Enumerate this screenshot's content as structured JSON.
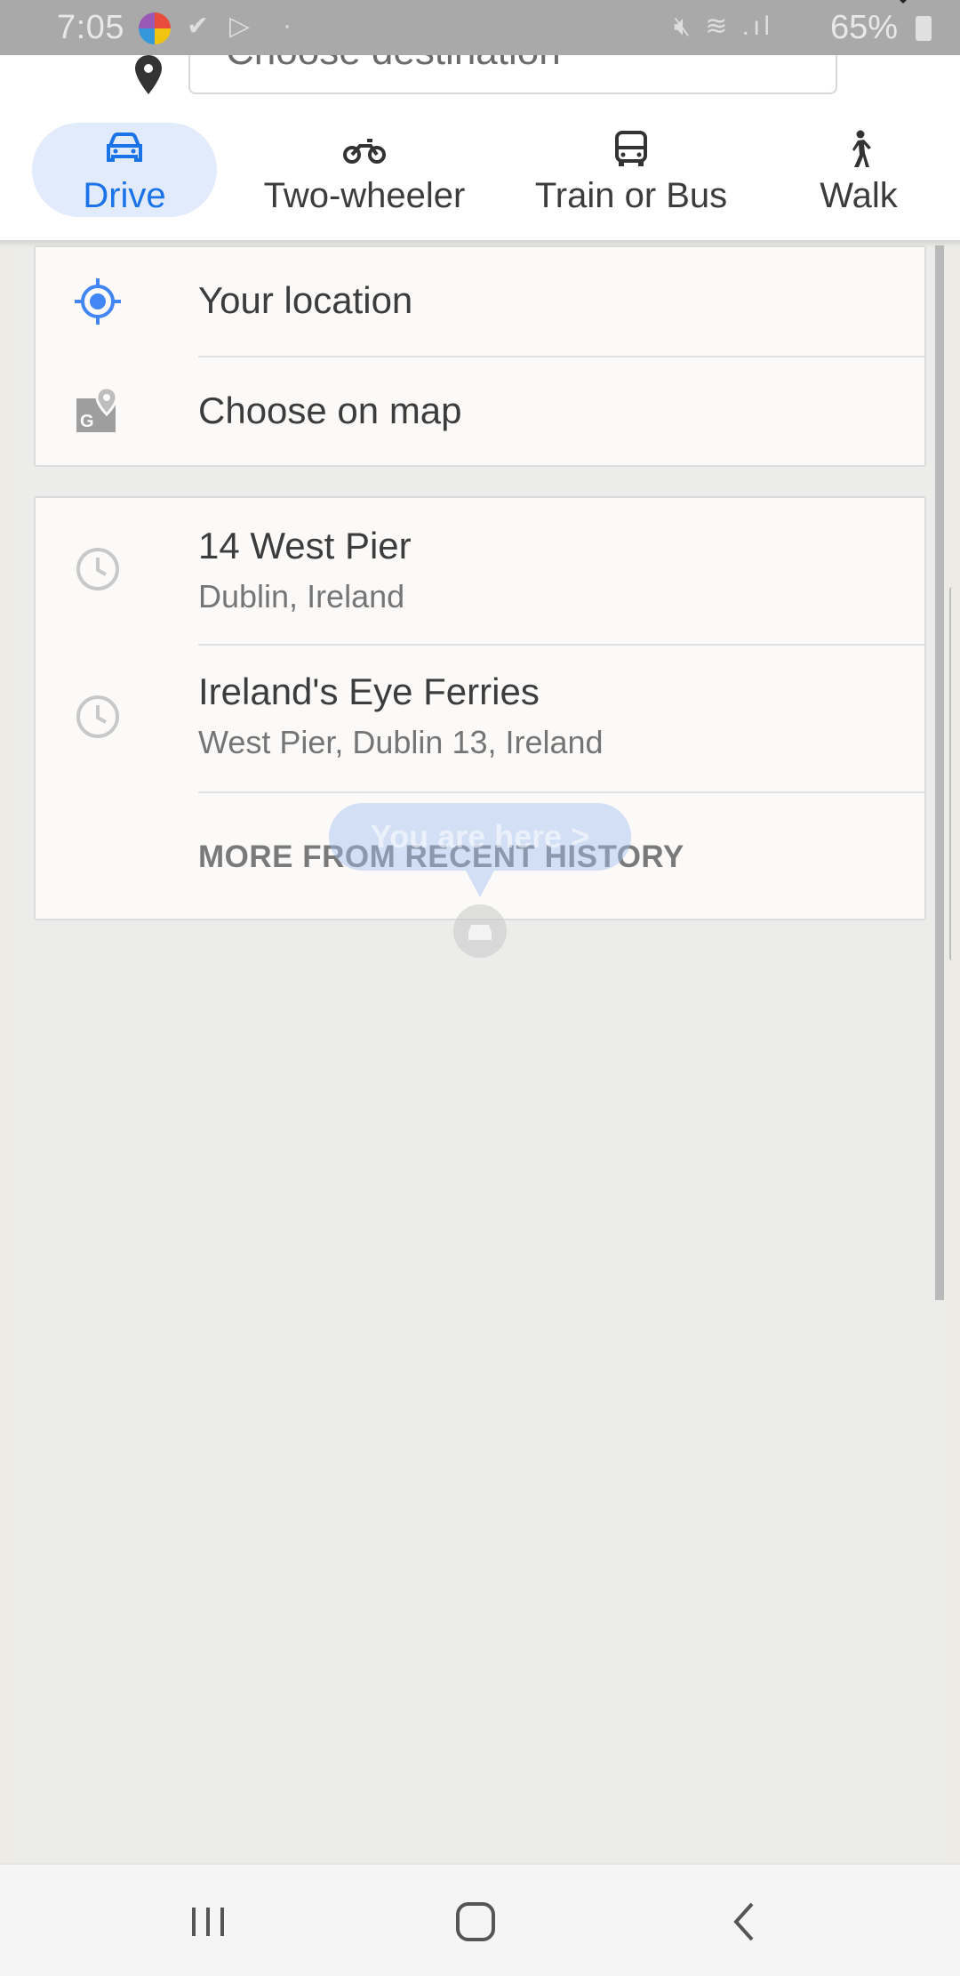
{
  "status_bar": {
    "time": "7:05",
    "battery": "65%",
    "icons": [
      "app-logo-icon",
      "check-notification-icon",
      "play-store-icon",
      "mute-icon",
      "wifi-icon",
      "signal-icon",
      "battery-icon"
    ]
  },
  "search": {
    "placeholder": "Choose destination"
  },
  "modes": [
    {
      "label": "Drive",
      "icon": "car-icon",
      "active": true
    },
    {
      "label": "Two-wheeler",
      "icon": "motorcycle-icon",
      "active": false
    },
    {
      "label": "Train or Bus",
      "icon": "bus-icon",
      "active": false
    },
    {
      "label": "Walk",
      "icon": "walk-icon",
      "active": false
    }
  ],
  "quick_options": [
    {
      "label": "Your location",
      "icon": "my-location-icon"
    },
    {
      "label": "Choose on map",
      "icon": "map-pin-icon"
    }
  ],
  "recent": [
    {
      "title": "14 West Pier",
      "subtitle": "Dublin, Ireland",
      "icon": "history-clock-icon"
    },
    {
      "title": "Ireland's Eye Ferries",
      "subtitle": "West Pier, Dublin 13, Ireland",
      "icon": "history-clock-icon"
    }
  ],
  "more_history_label": "MORE FROM RECENT HISTORY",
  "map_overlay": {
    "you_are_here": "You are here  >"
  },
  "colors": {
    "accent": "#1a73e8",
    "active_tab_bg": "#e2ebfb"
  }
}
